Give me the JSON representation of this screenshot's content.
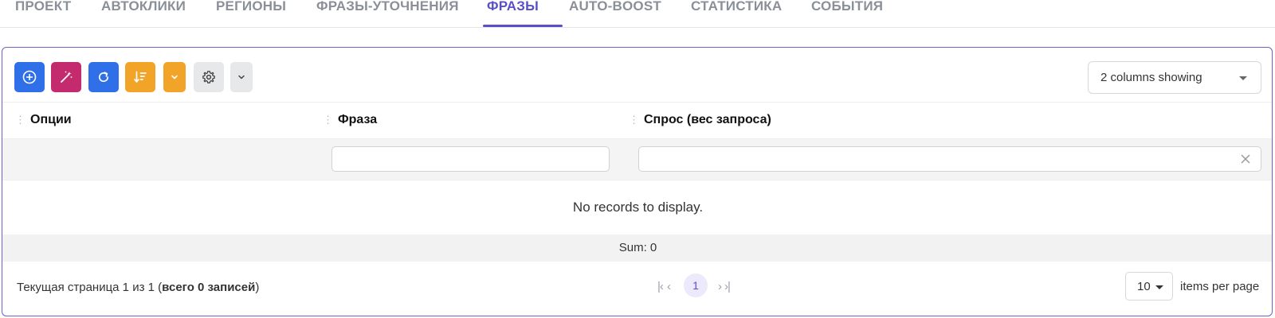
{
  "tabs": [
    {
      "label": "ПРОЕКТ"
    },
    {
      "label": "АВТОКЛИКИ"
    },
    {
      "label": "РЕГИОНЫ"
    },
    {
      "label": "ФРАЗЫ-УТОЧНЕНИЯ"
    },
    {
      "label": "ФРАЗЫ",
      "active": true
    },
    {
      "label": "AUTO-BOOST"
    },
    {
      "label": "СТАТИСТИКА"
    },
    {
      "label": "СОБЫТИЯ"
    }
  ],
  "toolbar": {
    "buttons": [
      {
        "icon": "plus-circle-icon",
        "color": "#2f6fe8"
      },
      {
        "icon": "magic-wand-icon",
        "color": "#c42b6e"
      },
      {
        "icon": "refresh-icon",
        "color": "#2f6fe8"
      },
      {
        "icon": "sort-icon",
        "color": "#f2a428"
      },
      {
        "icon": "chevron-down-icon",
        "color": "#f2a428"
      },
      {
        "icon": "gear-icon",
        "color": "#e7e8ea"
      },
      {
        "icon": "chevron-down-icon",
        "color": "#e7e8ea"
      }
    ],
    "columns_select": "2 columns showing"
  },
  "table": {
    "columns": [
      {
        "label": "Опции"
      },
      {
        "label": "Фраза"
      },
      {
        "label": "Спрос (вес запроса)"
      }
    ],
    "filters": {
      "phrase_value": "",
      "demand_value": ""
    },
    "empty_message": "No records to display.",
    "sum_label": "Sum: 0"
  },
  "footer": {
    "page_info_prefix": "Текущая страница 1 из 1 (",
    "page_info_bold": "всего 0 записей",
    "page_info_suffix": ")",
    "current_page": "1",
    "pager_first": "|‹",
    "pager_prev": "‹",
    "pager_next": "›",
    "pager_last": "›|",
    "per_page_value": "10",
    "per_page_label": "items per page"
  },
  "colors": {
    "accent": "#5b4fc7",
    "primary_blue": "#2f6fe8",
    "magenta": "#c42b6e",
    "orange": "#f2a428"
  }
}
